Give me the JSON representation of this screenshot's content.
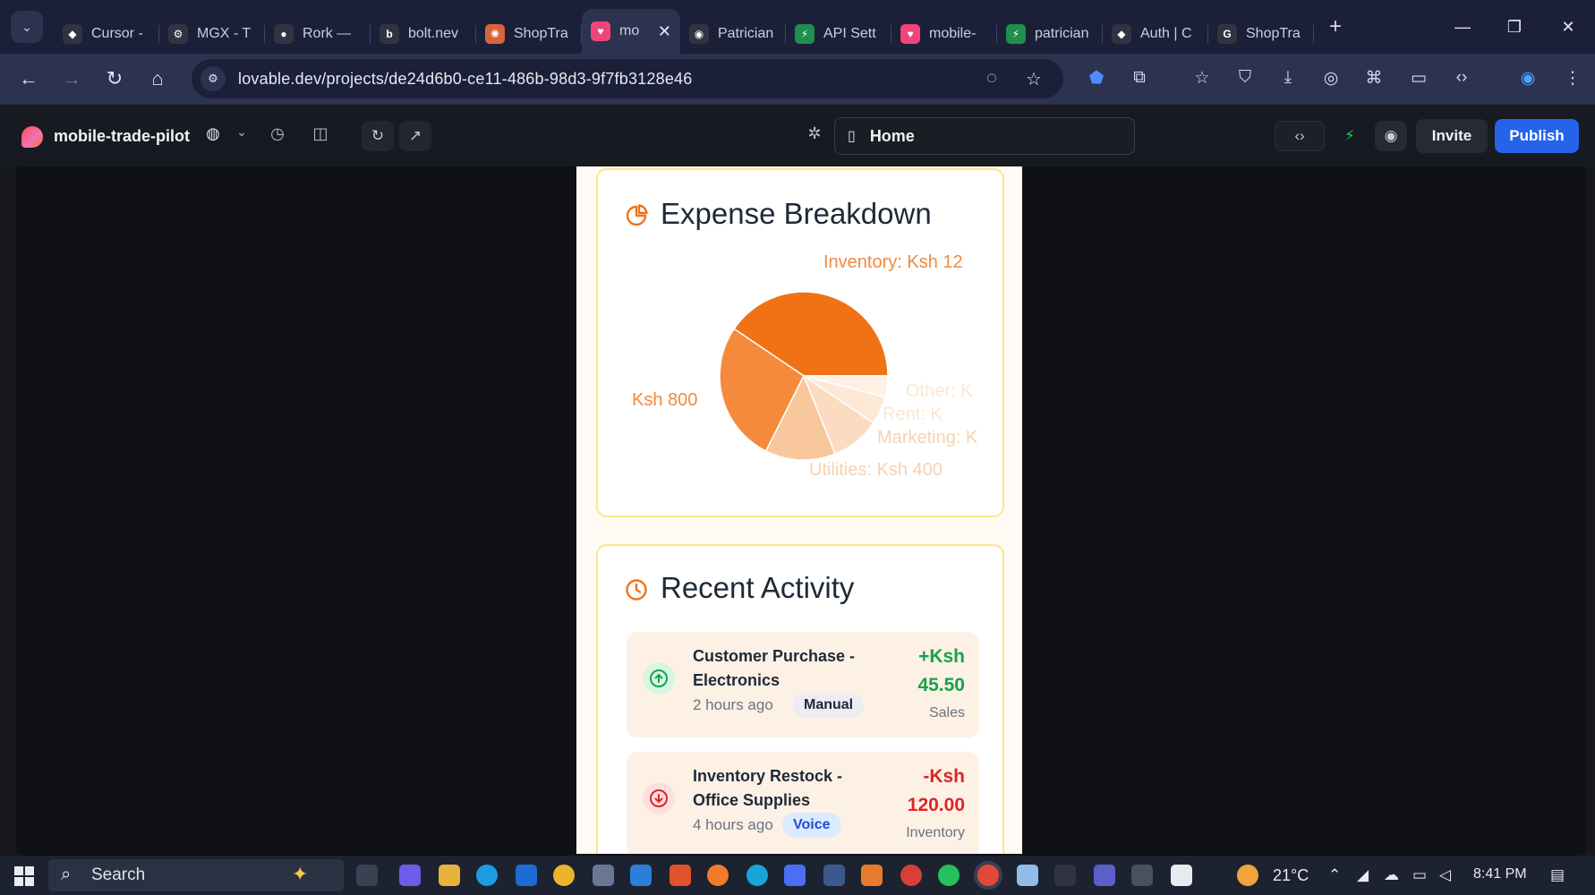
{
  "browser": {
    "tabs": [
      {
        "label": "Cursor -",
        "color": "#2f3342",
        "glyph": "◆"
      },
      {
        "label": "MGX - T",
        "color": "#2f3342",
        "glyph": "⚙"
      },
      {
        "label": "Rork —",
        "color": "#2f3342",
        "glyph": "●"
      },
      {
        "label": "bolt.nev",
        "color": "#2f3342",
        "glyph": "b"
      },
      {
        "label": "ShopTra",
        "color": "#d9643a",
        "glyph": "✺"
      },
      {
        "label": "mo",
        "color": "#f0447c",
        "glyph": "♥",
        "active": true
      },
      {
        "label": "Patrician",
        "color": "#2f3342",
        "glyph": "◉"
      },
      {
        "label": "API Sett",
        "color": "#1f8f4e",
        "glyph": "⚡"
      },
      {
        "label": "mobile-",
        "color": "#f0447c",
        "glyph": "♥"
      },
      {
        "label": "patrician",
        "color": "#1f8f4e",
        "glyph": "⚡"
      },
      {
        "label": "Auth | C",
        "color": "#2f3342",
        "glyph": "◆"
      },
      {
        "label": "ShopTra",
        "color": "#2f3342",
        "glyph": "G"
      }
    ],
    "active_tab_close": "✕",
    "new_tab": "+",
    "url": "lovable.dev/projects/de24d6b0-ce11-486b-98d3-9f7fb3128e46"
  },
  "app": {
    "project_name": "mobile-trade-pilot",
    "route": "Home",
    "invite_label": "Invite",
    "publish_label": "Publish",
    "accent": "#2563eb"
  },
  "expense": {
    "title": "Expense Breakdown",
    "labels": {
      "inventory": "Inventory: Ksh 12",
      "left": "Ksh 800",
      "other": "Other: K",
      "rent": "Rent: K",
      "marketing": "Marketing: K",
      "utilities": "Utilities: Ksh 400"
    }
  },
  "chart_data": {
    "type": "pie",
    "title": "Expense Breakdown",
    "slices": [
      {
        "label": "Inventory",
        "value": 1200,
        "color": "#f07214"
      },
      {
        "label": "",
        "value": 800,
        "color": "#f68a3c"
      },
      {
        "label": "Utilities",
        "value": 400,
        "color": "#f9c79c"
      },
      {
        "label": "Marketing",
        "value": 280,
        "color": "#fbdcc0"
      },
      {
        "label": "Rent",
        "value": 160,
        "color": "#fde8d5"
      },
      {
        "label": "Other",
        "value": 120,
        "color": "#fef1e4"
      }
    ]
  },
  "activity": {
    "title": "Recent Activity",
    "items": [
      {
        "title": "Customer Purchase - Electronics",
        "time": "2 hours ago",
        "badge": "Manual",
        "amount_sign": "+Ksh",
        "amount": "45.50",
        "category": "Sales",
        "type": "income"
      },
      {
        "title": "Inventory Restock - Office Supplies",
        "time": "4 hours ago",
        "badge": "Voice",
        "amount_sign": "-Ksh",
        "amount": "120.00",
        "category": "Inventory",
        "type": "expense"
      }
    ]
  },
  "taskbar": {
    "search_placeholder": "Search",
    "weather": "21°C",
    "time": "8:41 PM"
  }
}
